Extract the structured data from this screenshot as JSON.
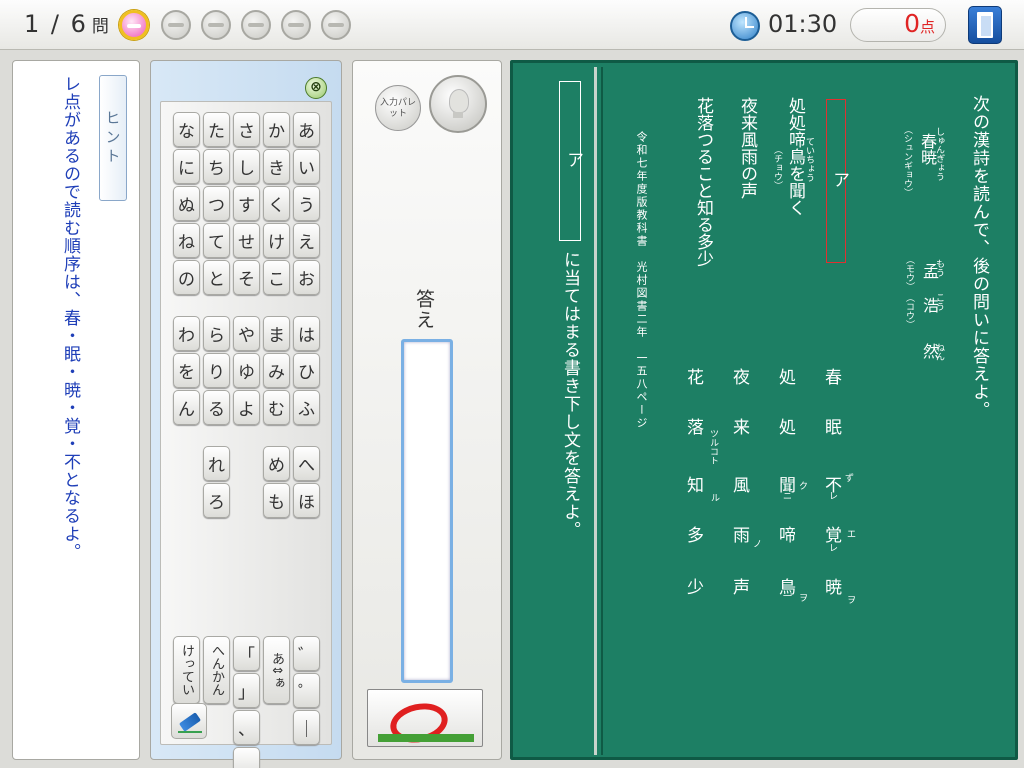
{
  "header": {
    "question_counter": "1 / 6",
    "question_unit": "問",
    "progress_total": 6,
    "progress_current": 1,
    "timer": "01:30",
    "score_value": "0",
    "score_unit": "点"
  },
  "hint": {
    "button_label": "ヒント",
    "text": "レ点があるので読む順序は、春・眠・暁・覚・不となるよ。"
  },
  "keyboard": {
    "close_symbol": "⊗",
    "rows": [
      [
        "な",
        "た",
        "さ",
        "か",
        "あ"
      ],
      [
        "に",
        "ち",
        "し",
        "き",
        "い"
      ],
      [
        "ぬ",
        "つ",
        "す",
        "く",
        "う"
      ],
      [
        "ね",
        "て",
        "せ",
        "け",
        "え"
      ],
      [
        "の",
        "と",
        "そ",
        "こ",
        "お"
      ],
      [
        "わ",
        "ら",
        "や",
        "ま",
        "は"
      ],
      [
        "を",
        "り",
        "ゆ",
        "み",
        "ひ"
      ],
      [
        "ん",
        "る",
        "よ",
        "む",
        "ふ"
      ],
      [
        "",
        "れ",
        "",
        "め",
        "へ"
      ],
      [
        "",
        "ろ",
        "",
        "も",
        "ほ"
      ]
    ],
    "func": {
      "kettei": "けってい",
      "henkan": "へんかん",
      "bracket_open": "「",
      "bracket_close": "」",
      "comma": "、",
      "period": "。",
      "small": "あ⇕ぁ",
      "dakuten": "゛",
      "handakuten": "゜",
      "long": "｜"
    }
  },
  "answer": {
    "palette_label": "入力パレット",
    "label": "答え",
    "value": ""
  },
  "question": {
    "blank_label": "ア",
    "instruction_tail": "に当てはまる書き下し文を答えよ。",
    "intro": "次の漢詩を読んで、後の問いに答えよ。",
    "title": "春暁",
    "title_ruby": "しゅんぎょう",
    "title_ruby2": "（シュンギョウ）",
    "author_1": "孟",
    "author_1_ruby": "もう",
    "author_1_ruby2": "（モウ）",
    "author_2": "浩",
    "author_2_ruby": "こう",
    "author_2_ruby2": "（コウ）",
    "author_3": "然",
    "author_3_ruby": "ねん",
    "line2": "処処啼鳥を聞く",
    "line2_ruby": "ていちょう",
    "line2_ruby2": "（チョウ）",
    "line3": "夜来風雨の声",
    "line4": "花落つること知る多少",
    "source": "令和七年度版教科書　光村図書二年　一五八ページ",
    "kanbun_line1": [
      "春",
      "眠",
      "不",
      "覚",
      "暁"
    ],
    "kanbun_line2": [
      "処",
      "処",
      "聞",
      "啼",
      "鳥"
    ],
    "kanbun_line3": [
      "夜",
      "来",
      "風",
      "雨",
      "声"
    ],
    "kanbun_line4": [
      "花",
      "落",
      "知",
      "多",
      "少"
    ],
    "kun": {
      "fu_okuri": "ず",
      "fu_re": "レ",
      "kaku_okuri": "エ",
      "kaku_re": "レ",
      "gyou_okuri": "ヲ",
      "mon_okuri": "ク",
      "mon_ni": "ニ",
      "chou_ichi": "一",
      "chou_wo": "ヲ",
      "u_no": "ノ",
      "raku_okuri": "ツルコト",
      "chi_okuri": "ル"
    }
  }
}
